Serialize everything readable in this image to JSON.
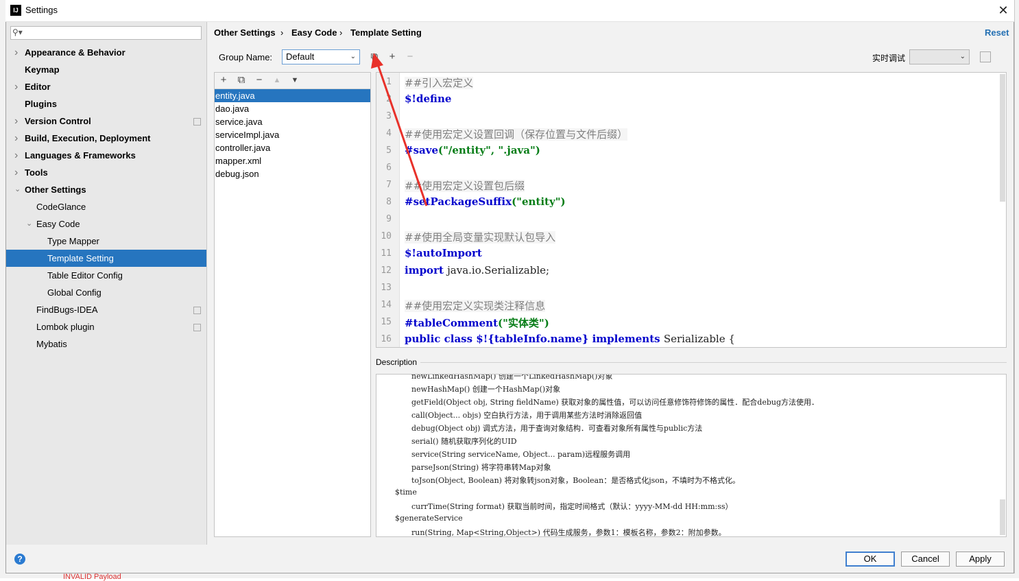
{
  "window": {
    "title": "Settings",
    "app_icon_label": "IJ"
  },
  "background": {
    "bottom_text": "INVALID Payload"
  },
  "sidebar": {
    "search_placeholder": "",
    "items": [
      {
        "label": "Appearance & Behavior",
        "level": 0,
        "bold": true,
        "expandable": true
      },
      {
        "label": "Keymap",
        "level": 0,
        "bold": true,
        "expandable": false
      },
      {
        "label": "Editor",
        "level": 0,
        "bold": true,
        "expandable": true
      },
      {
        "label": "Plugins",
        "level": 0,
        "bold": true,
        "expandable": false
      },
      {
        "label": "Version Control",
        "level": 0,
        "bold": true,
        "expandable": true
      },
      {
        "label": "Build, Execution, Deployment",
        "level": 0,
        "bold": true,
        "expandable": true
      },
      {
        "label": "Languages & Frameworks",
        "level": 0,
        "bold": true,
        "expandable": true
      },
      {
        "label": "Tools",
        "level": 0,
        "bold": true,
        "expandable": true
      },
      {
        "label": "Other Settings",
        "level": 0,
        "bold": true,
        "expanded": true
      },
      {
        "label": "CodeGlance",
        "level": 1
      },
      {
        "label": "Easy Code",
        "level": 1,
        "expanded": true
      },
      {
        "label": "Type Mapper",
        "level": 2
      },
      {
        "label": "Template Setting",
        "level": 2,
        "selected": true
      },
      {
        "label": "Table Editor Config",
        "level": 2
      },
      {
        "label": "Global Config",
        "level": 2
      },
      {
        "label": "FindBugs-IDEA",
        "level": 1
      },
      {
        "label": "Lombok plugin",
        "level": 1
      },
      {
        "label": "Mybatis",
        "level": 1
      }
    ]
  },
  "breadcrumb": [
    "Other Settings",
    "Easy Code",
    "Template Setting"
  ],
  "breadcrumb_sep": "›",
  "reset_label": "Reset",
  "group": {
    "label": "Group Name:",
    "value": "Default"
  },
  "realtime_debug_label": "实时调试",
  "files": [
    "entity.java",
    "dao.java",
    "service.java",
    "serviceImpl.java",
    "controller.java",
    "mapper.xml",
    "debug.json"
  ],
  "selected_file": "entity.java",
  "editor": {
    "lines": [
      {
        "n": "1",
        "parts": [
          {
            "t": "##引入宏定义",
            "c": "cmt"
          }
        ]
      },
      {
        "n": "2",
        "parts": [
          {
            "t": "$!define",
            "c": "kw"
          }
        ]
      },
      {
        "n": "3",
        "parts": []
      },
      {
        "n": "4",
        "parts": [
          {
            "t": "##使用宏定义设置回调（保存位置与文件后缀）",
            "c": "cmt"
          }
        ]
      },
      {
        "n": "5",
        "parts": [
          {
            "t": "#save",
            "c": "kw"
          },
          {
            "t": "(\"/entity\", \".java\")",
            "c": "str"
          }
        ]
      },
      {
        "n": "6",
        "parts": []
      },
      {
        "n": "7",
        "parts": [
          {
            "t": "##使用宏定义设置包后缀",
            "c": "cmt"
          }
        ]
      },
      {
        "n": "8",
        "parts": [
          {
            "t": "#setPackageSuffix",
            "c": "kw"
          },
          {
            "t": "(\"entity\")",
            "c": "str"
          }
        ]
      },
      {
        "n": "9",
        "parts": []
      },
      {
        "n": "10",
        "parts": [
          {
            "t": "##使用全局变量实现默认包导入",
            "c": "cmt"
          }
        ]
      },
      {
        "n": "11",
        "parts": [
          {
            "t": "$!autoImport",
            "c": "kw"
          }
        ]
      },
      {
        "n": "12",
        "parts": [
          {
            "t": "import ",
            "c": "kw"
          },
          {
            "t": "java.io.Serializable;",
            "c": "plain"
          }
        ]
      },
      {
        "n": "13",
        "parts": []
      },
      {
        "n": "14",
        "parts": [
          {
            "t": "##使用宏定义实现类注释信息",
            "c": "cmt"
          }
        ]
      },
      {
        "n": "15",
        "parts": [
          {
            "t": "#tableComment",
            "c": "kw"
          },
          {
            "t": "(\"实体类\")",
            "c": "str"
          }
        ]
      },
      {
        "n": "16",
        "parts": [
          {
            "t": "public class ",
            "c": "kw"
          },
          {
            "t": "$!{tableInfo.name}",
            "c": "kw"
          },
          {
            "t": " implements ",
            "c": "kw"
          },
          {
            "t": "Serializable {",
            "c": "plain"
          }
        ]
      }
    ]
  },
  "description": {
    "label": "Description",
    "lines": [
      {
        "indent": 2,
        "text": "newLinkedHashMap() 创建一个LinkedHashMap()对象"
      },
      {
        "indent": 2,
        "text": "newHashMap() 创建一个HashMap()对象"
      },
      {
        "indent": 2,
        "text": "getField(Object obj, String fieldName) 获取对象的属性值，可以访问任意修饰符修饰的属性．配合debug方法使用．"
      },
      {
        "indent": 2,
        "text": "call(Object... objs) 空白执行方法，用于调用某些方法时消除返回值"
      },
      {
        "indent": 2,
        "text": "debug(Object obj) 调式方法，用于查询对象结构．可查看对象所有属性与public方法"
      },
      {
        "indent": 2,
        "text": "serial() 随机获取序列化的UID"
      },
      {
        "indent": 2,
        "text": "service(String serviceName, Object... param)远程服务调用"
      },
      {
        "indent": 2,
        "text": "parseJson(String) 将字符串转Map对象"
      },
      {
        "indent": 2,
        "text": "toJson(Object, Boolean) 将对象转json对象，Boolean：是否格式化json，不填时为不格式化。"
      },
      {
        "indent": 1,
        "text": "$time"
      },
      {
        "indent": 2,
        "text": "currTime(String format) 获取当前时间，指定时间格式（默认：yyyy-MM-dd HH:mm:ss）"
      },
      {
        "indent": 1,
        "text": "$generateService"
      },
      {
        "indent": 2,
        "text": "run(String, Map<String,Object>) 代码生成服务，参数1：模板名称，参数2：附加参数。"
      }
    ]
  },
  "buttons": {
    "ok": "OK",
    "cancel": "Cancel",
    "apply": "Apply",
    "help": "?"
  },
  "colors": {
    "selection": "#2675bf",
    "link": "#2470b3",
    "annotation_arrow": "#e8312a"
  }
}
